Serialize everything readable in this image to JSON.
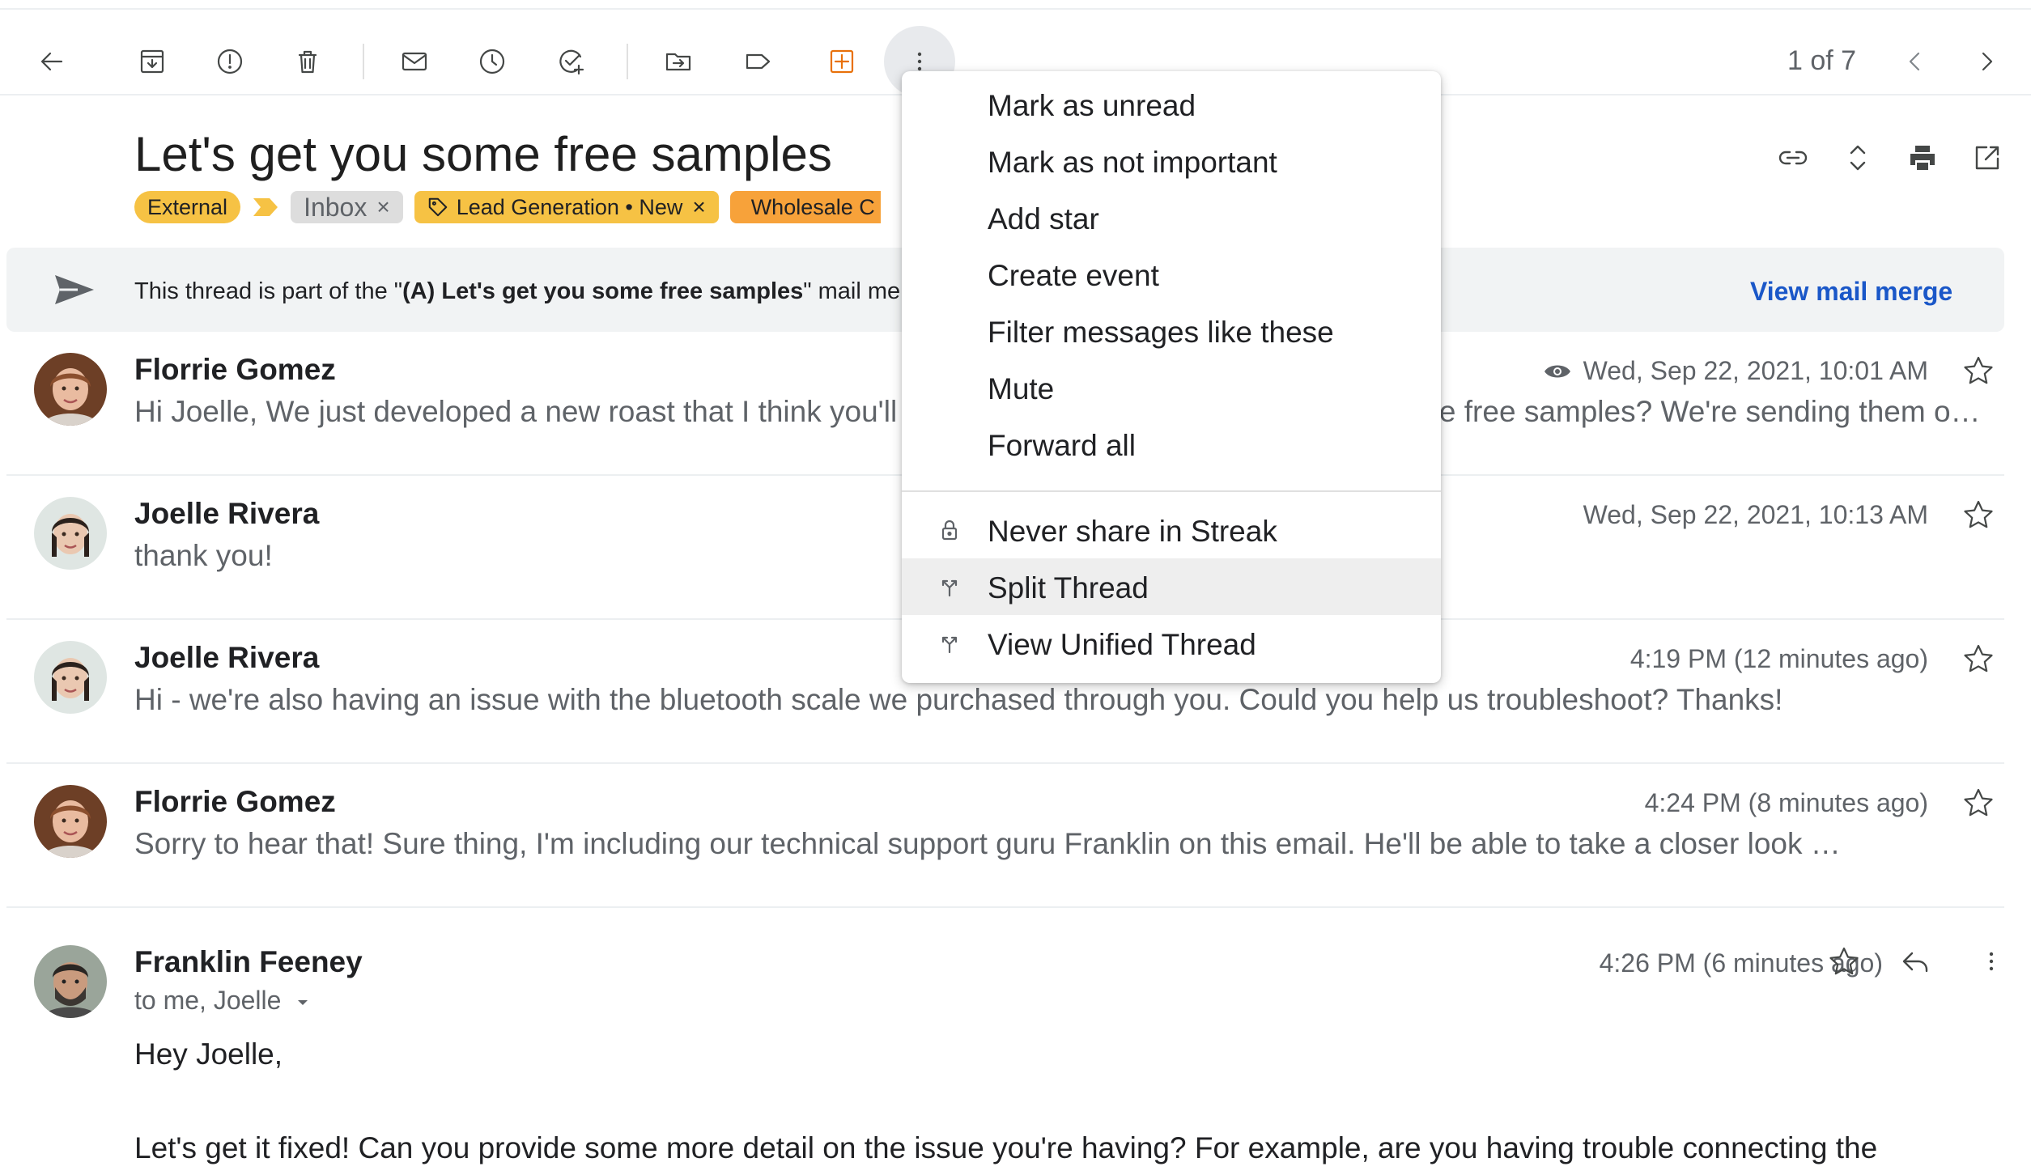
{
  "toolbar": {
    "pager_text": "1 of 7",
    "icons": [
      "back-arrow-icon",
      "archive-icon",
      "report-spam-icon",
      "delete-icon",
      "mark-unread-icon",
      "snooze-icon",
      "add-to-tasks-icon",
      "move-to-icon",
      "label-icon",
      "streak-icon",
      "more-vert-icon",
      "chevron-left-icon",
      "chevron-right-icon"
    ],
    "streak_color": "#e8710a"
  },
  "thread": {
    "subject": "Let's get you some free samples",
    "labels": [
      {
        "text": "External",
        "color": "#f6c244"
      },
      {
        "text": "Inbox",
        "color": "#dddddd",
        "removable": "×"
      },
      {
        "text": "Lead Generation • New",
        "color": "#f6c244",
        "removable": "×"
      },
      {
        "text": "Wholesale C",
        "color": "#f7a23a"
      }
    ]
  },
  "banner": {
    "prefix": "This thread is part of the \"",
    "bold": "(A) Let's get you some free samples",
    "suffix": "\" mail merge",
    "link": "View mail merge",
    "link_color": "#1a57c8"
  },
  "messages": [
    {
      "sender": "Florrie Gomez",
      "snippet": "Hi Joelle, We just developed a new roast that I think you'll love. Would you be interested to try some free samples? We're sending them out this week…",
      "date": "Wed, Sep 22, 2021, 10:01 AM",
      "tracked": true
    },
    {
      "sender": "Joelle Rivera",
      "snippet": "thank you!",
      "date": "Wed, Sep 22, 2021, 10:13 AM"
    },
    {
      "sender": "Joelle Rivera",
      "snippet": "Hi - we're also having an issue with the bluetooth scale we purchased through you. Could you help us troubleshoot? Thanks!",
      "date": "4:19 PM (12 minutes ago)"
    },
    {
      "sender": "Florrie Gomez",
      "snippet": "Sorry to hear that! Sure thing, I'm including our technical support guru Franklin on this email. He'll be able to take a closer look …",
      "date": "4:24 PM (8 minutes ago)"
    }
  ],
  "open_message": {
    "sender": "Franklin Feeney",
    "recipients": "to me, Joelle",
    "date": "4:26 PM (6 minutes ago)",
    "greeting": "Hey Joelle,",
    "body": "Let's get it fixed! Can you provide some more detail on the issue you're having? For example, are you having trouble connecting the"
  },
  "menu": {
    "items": [
      {
        "label": "Mark as unread"
      },
      {
        "label": "Mark as not important"
      },
      {
        "label": "Add star"
      },
      {
        "label": "Create event"
      },
      {
        "label": "Filter messages like these"
      },
      {
        "label": "Mute"
      },
      {
        "label": "Forward all"
      },
      {
        "label": "Never share in Streak",
        "icon": "lock-icon"
      },
      {
        "label": "Split Thread",
        "icon": "split-icon",
        "hovered": true
      },
      {
        "label": "View Unified Thread",
        "icon": "merge-icon"
      }
    ]
  }
}
